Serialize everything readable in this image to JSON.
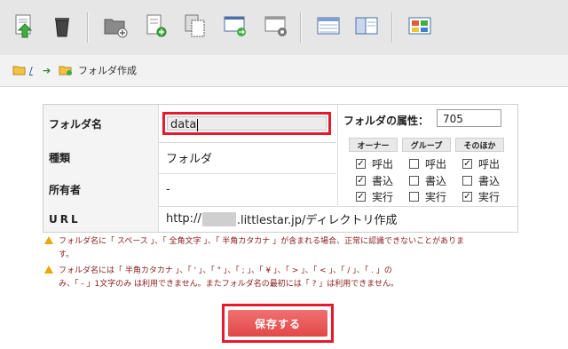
{
  "toolbar": {
    "buttons": [
      {
        "icon": "upload-file-icon"
      },
      {
        "icon": "trash-icon"
      },
      {
        "icon": "new-folder-icon"
      },
      {
        "icon": "new-file-icon"
      },
      {
        "icon": "copy-icon"
      },
      {
        "icon": "move-icon"
      },
      {
        "icon": "settings-icon"
      },
      {
        "icon": "list-view-icon"
      },
      {
        "icon": "detail-view-icon"
      },
      {
        "icon": "thumbnail-view-icon"
      }
    ]
  },
  "breadcrumb": {
    "root": "/",
    "current": "フォルダ作成"
  },
  "form": {
    "folder_name_label": "フォルダ名",
    "folder_name_value": "data",
    "type_label": "種類",
    "type_value": "フォルダ",
    "owner_label": "所有者",
    "owner_value": "-",
    "url_label": "URL",
    "url_prefix": "http://",
    "url_suffix": ".littlestar.jp/ディレクトリ作成"
  },
  "permissions": {
    "title": "フォルダの属性：",
    "value": "705",
    "headers": [
      "オーナー",
      "グループ",
      "そのほか"
    ],
    "rows": [
      {
        "label": "呼出",
        "checked": [
          true,
          false,
          true
        ]
      },
      {
        "label": "書込",
        "checked": [
          true,
          false,
          false
        ]
      },
      {
        "label": "実行",
        "checked": [
          true,
          false,
          true
        ]
      }
    ]
  },
  "notes": {
    "note1": "フォルダ名に「 スペース 」、「 全角文字 」、「 半角カタカナ 」が含まれる場合、正常に認識できないことがありま",
    "note1b": "す。",
    "note2": "フォルダ名には「 半角カタカナ 」、「 ' 」、「 \" 」、「 ; 」、「 ¥ 」、「 > 」、「 < 」、「 / 」、「 . 」の",
    "note2b": "み、「 - 」1文字のみ は利用できません。またフォルダ名の最初には「 ? 」は利用できません。"
  },
  "save_label": "保存する",
  "colors": {
    "highlight": "#e8192c",
    "button": "#e24848",
    "warning": "#e8a800",
    "note_text": "#8b1a1a"
  }
}
